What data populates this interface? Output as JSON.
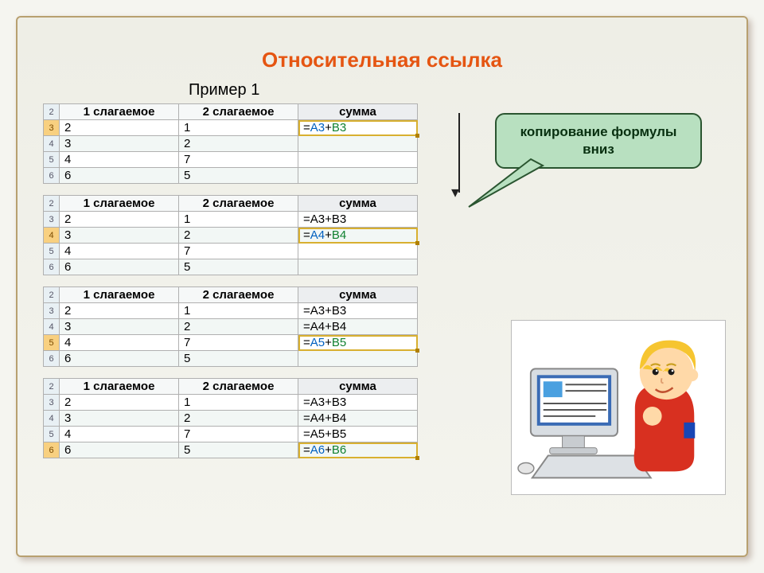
{
  "title": "Относительная ссылка",
  "subtitle": "Пример 1",
  "headers": {
    "col1": "1 слагаемое",
    "col2": "2 слагаемое",
    "col3": "сумма"
  },
  "callout": {
    "line1": "копирование формулы",
    "line2": "вниз"
  },
  "tables": [
    {
      "highlight_row": 3,
      "rows": [
        {
          "n": 2,
          "header": true
        },
        {
          "n": 3,
          "a": "2",
          "b": "1",
          "c": {
            "formula": true,
            "a": "A3",
            "b": "B3",
            "eq": true
          },
          "active": true
        },
        {
          "n": 4,
          "a": "3",
          "b": "2",
          "c": ""
        },
        {
          "n": 5,
          "a": "4",
          "b": "7",
          "c": ""
        },
        {
          "n": 6,
          "a": "6",
          "b": "5",
          "c": ""
        }
      ]
    },
    {
      "highlight_row": 4,
      "rows": [
        {
          "n": 2,
          "header": true
        },
        {
          "n": 3,
          "a": "2",
          "b": "1",
          "c": "=A3+B3"
        },
        {
          "n": 4,
          "a": "3",
          "b": "2",
          "c": {
            "formula": true,
            "a": "A4",
            "b": "B4",
            "eq": true
          },
          "active": true
        },
        {
          "n": 5,
          "a": "4",
          "b": "7",
          "c": ""
        },
        {
          "n": 6,
          "a": "6",
          "b": "5",
          "c": ""
        }
      ]
    },
    {
      "highlight_row": 5,
      "rows": [
        {
          "n": 2,
          "header": true
        },
        {
          "n": 3,
          "a": "2",
          "b": "1",
          "c": "=A3+B3"
        },
        {
          "n": 4,
          "a": "3",
          "b": "2",
          "c": "=A4+B4"
        },
        {
          "n": 5,
          "a": "4",
          "b": "7",
          "c": {
            "formula": true,
            "a": "A5",
            "b": "B5",
            "eq": true
          },
          "active": true
        },
        {
          "n": 6,
          "a": "6",
          "b": "5",
          "c": ""
        }
      ]
    },
    {
      "highlight_row": 6,
      "rows": [
        {
          "n": 2,
          "header": true
        },
        {
          "n": 3,
          "a": "2",
          "b": "1",
          "c": "=A3+B3"
        },
        {
          "n": 4,
          "a": "3",
          "b": "2",
          "c": "=A4+B4"
        },
        {
          "n": 5,
          "a": "4",
          "b": "7",
          "c": "=A5+B5"
        },
        {
          "n": 6,
          "a": "6",
          "b": "5",
          "c": {
            "formula": true,
            "a": "A6",
            "b": "B6",
            "eq": true
          },
          "active": true
        }
      ]
    }
  ]
}
